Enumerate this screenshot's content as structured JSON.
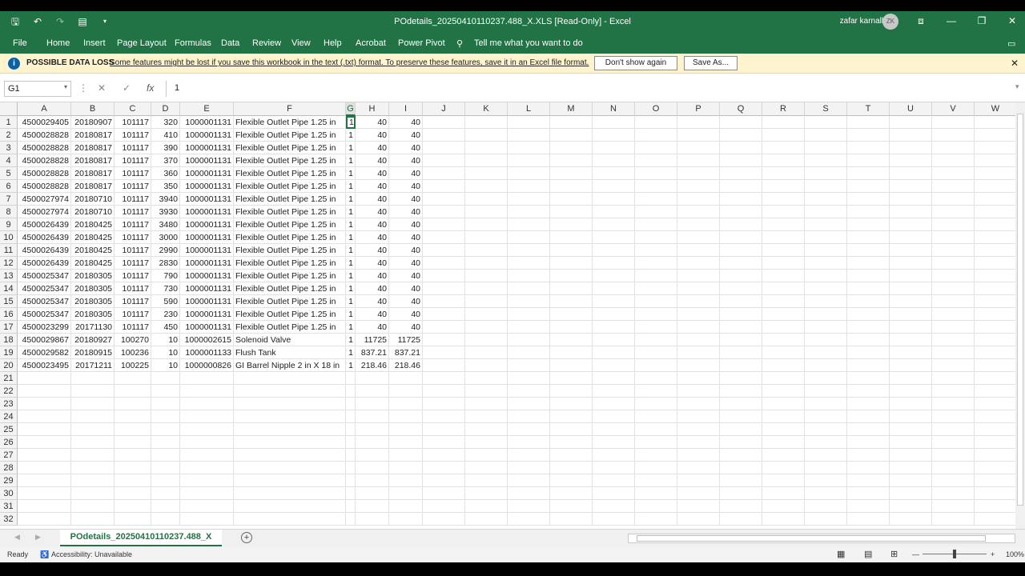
{
  "window": {
    "title": "POdetails_20250410110237.488_X.XLS  [Read-Only]  -  Excel",
    "user_name": "zafar karnallar",
    "avatar_initials": "ZK"
  },
  "menu": [
    "File",
    "Home",
    "Insert",
    "Page Layout",
    "Formulas",
    "Data",
    "Review",
    "View",
    "Help",
    "Acrobat",
    "Power Pivot",
    "Tell me what you want to do"
  ],
  "infobar": {
    "heading": "POSSIBLE DATA LOSS",
    "message": "Some features might be lost if you save this workbook in the text (.txt) format. To preserve these features, save it in an Excel file format.",
    "dont_show": "Don't show again",
    "save_as": "Save As..."
  },
  "formula_bar": {
    "name_box": "G1",
    "fx": "fx",
    "value": "1"
  },
  "columns": [
    "A",
    "B",
    "C",
    "D",
    "E",
    "F",
    "G",
    "H",
    "I",
    "J",
    "K",
    "L",
    "M",
    "N",
    "O",
    "P",
    "Q",
    "R",
    "S",
    "T",
    "U",
    "V",
    "W"
  ],
  "rows": [
    [
      "4500029405",
      "20180907",
      "101117",
      "320",
      "1000001131",
      "Flexible Outlet Pipe 1.25 in",
      "1",
      "40",
      "40"
    ],
    [
      "4500028828",
      "20180817",
      "101117",
      "410",
      "1000001131",
      "Flexible Outlet Pipe 1.25 in",
      "1",
      "40",
      "40"
    ],
    [
      "4500028828",
      "20180817",
      "101117",
      "390",
      "1000001131",
      "Flexible Outlet Pipe 1.25 in",
      "1",
      "40",
      "40"
    ],
    [
      "4500028828",
      "20180817",
      "101117",
      "370",
      "1000001131",
      "Flexible Outlet Pipe 1.25 in",
      "1",
      "40",
      "40"
    ],
    [
      "4500028828",
      "20180817",
      "101117",
      "360",
      "1000001131",
      "Flexible Outlet Pipe 1.25 in",
      "1",
      "40",
      "40"
    ],
    [
      "4500028828",
      "20180817",
      "101117",
      "350",
      "1000001131",
      "Flexible Outlet Pipe 1.25 in",
      "1",
      "40",
      "40"
    ],
    [
      "4500027974",
      "20180710",
      "101117",
      "3940",
      "1000001131",
      "Flexible Outlet Pipe 1.25 in",
      "1",
      "40",
      "40"
    ],
    [
      "4500027974",
      "20180710",
      "101117",
      "3930",
      "1000001131",
      "Flexible Outlet Pipe 1.25 in",
      "1",
      "40",
      "40"
    ],
    [
      "4500026439",
      "20180425",
      "101117",
      "3480",
      "1000001131",
      "Flexible Outlet Pipe 1.25 in",
      "1",
      "40",
      "40"
    ],
    [
      "4500026439",
      "20180425",
      "101117",
      "3000",
      "1000001131",
      "Flexible Outlet Pipe 1.25 in",
      "1",
      "40",
      "40"
    ],
    [
      "4500026439",
      "20180425",
      "101117",
      "2990",
      "1000001131",
      "Flexible Outlet Pipe 1.25 in",
      "1",
      "40",
      "40"
    ],
    [
      "4500026439",
      "20180425",
      "101117",
      "2830",
      "1000001131",
      "Flexible Outlet Pipe 1.25 in",
      "1",
      "40",
      "40"
    ],
    [
      "4500025347",
      "20180305",
      "101117",
      "790",
      "1000001131",
      "Flexible Outlet Pipe 1.25 in",
      "1",
      "40",
      "40"
    ],
    [
      "4500025347",
      "20180305",
      "101117",
      "730",
      "1000001131",
      "Flexible Outlet Pipe 1.25 in",
      "1",
      "40",
      "40"
    ],
    [
      "4500025347",
      "20180305",
      "101117",
      "590",
      "1000001131",
      "Flexible Outlet Pipe 1.25 in",
      "1",
      "40",
      "40"
    ],
    [
      "4500025347",
      "20180305",
      "101117",
      "230",
      "1000001131",
      "Flexible Outlet Pipe 1.25 in",
      "1",
      "40",
      "40"
    ],
    [
      "4500023299",
      "20171130",
      "101117",
      "450",
      "1000001131",
      "Flexible Outlet Pipe 1.25 in",
      "1",
      "40",
      "40"
    ],
    [
      "4500029867",
      "20180927",
      "100270",
      "10",
      "1000002615",
      "Solenoid Valve",
      "1",
      "11725",
      "11725"
    ],
    [
      "4500029582",
      "20180915",
      "100236",
      "10",
      "1000001133",
      "Flush Tank",
      "1",
      "837.21",
      "837.21"
    ],
    [
      "4500023495",
      "20171211",
      "100225",
      "10",
      "1000000826",
      "GI Barrel Nipple 2 in X 18 in",
      "1",
      "218.46",
      "218.46"
    ]
  ],
  "row_count": 32,
  "active_cell": {
    "row": 1,
    "col": "G"
  },
  "sheet_tab": "POdetails_20250410110237.488_X",
  "status": {
    "ready": "Ready",
    "accessibility": "Accessibility: Unavailable",
    "zoom": "100%"
  }
}
